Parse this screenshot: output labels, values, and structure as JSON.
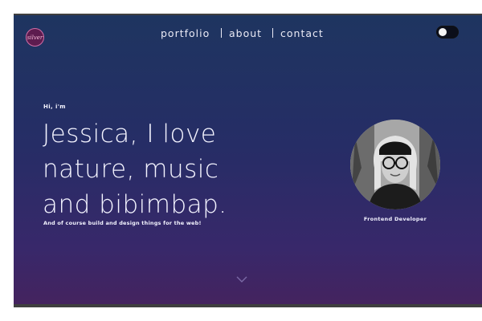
{
  "logo": {
    "text": "silver",
    "icon": "silver-logo-icon",
    "ring_color": "#d26ea7"
  },
  "nav": {
    "items": [
      {
        "label": "portfolio"
      },
      {
        "label": "about"
      },
      {
        "label": "contact"
      }
    ]
  },
  "theme_toggle": {
    "state": "dark"
  },
  "hero": {
    "greeting": "Hi, i'm",
    "headline": [
      "Jessica, I love",
      "nature, music",
      "and bibimbap."
    ],
    "tagline": "And of course build and design things for the web!",
    "role": "Frontend Developer"
  },
  "scroll": {
    "icon": "chevron-down-icon"
  },
  "colors": {
    "background_top": "#1e3560",
    "background_bottom": "#45235e",
    "text": "#f3f3ff"
  }
}
